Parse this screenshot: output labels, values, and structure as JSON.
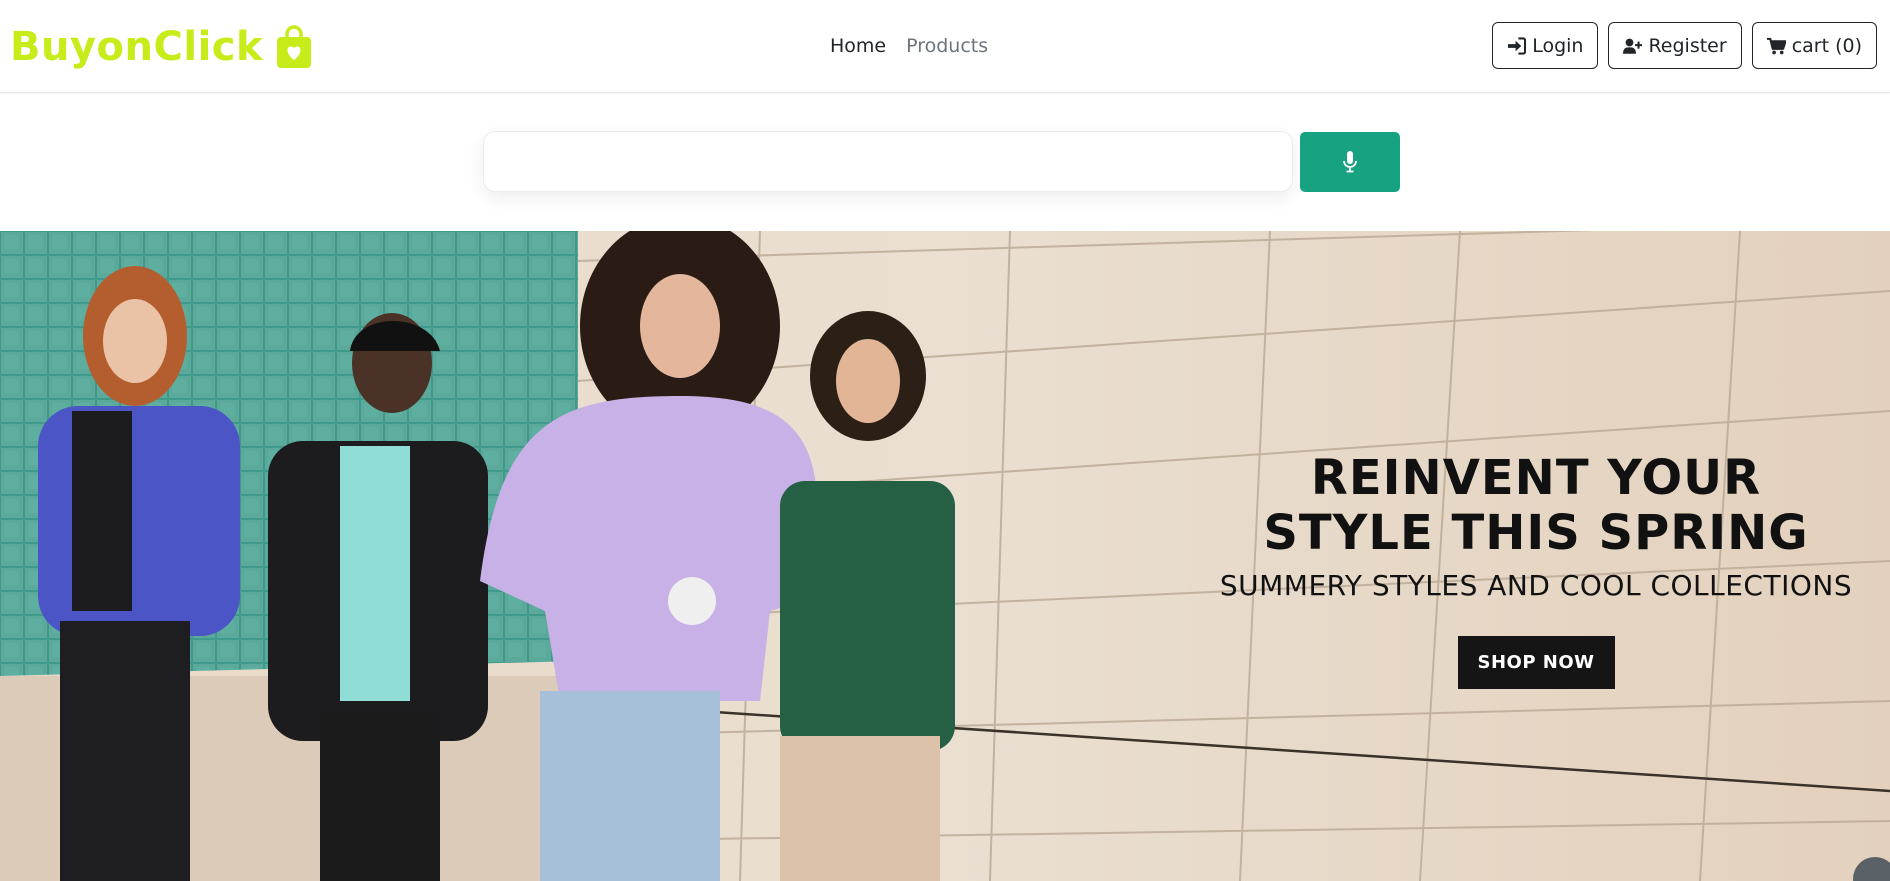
{
  "brand": {
    "name": "BuyonClick",
    "color": "#c6ec19",
    "icon": "shopping-bag-heart-icon"
  },
  "nav": {
    "links": [
      {
        "label": "Home",
        "active": true
      },
      {
        "label": "Products",
        "active": false
      }
    ],
    "buttons": [
      {
        "label": "Login",
        "icon": "sign-in-icon"
      },
      {
        "label": "Register",
        "icon": "user-plus-icon"
      },
      {
        "label": "cart (0)",
        "icon": "cart-icon"
      }
    ]
  },
  "search": {
    "value": "",
    "placeholder": "",
    "mic_icon": "microphone-icon",
    "mic_color": "#17a382"
  },
  "hero": {
    "headline_line1": "REINVENT YOUR",
    "headline_line2": "STYLE THIS SPRING",
    "subheadline": "SUMMERY STYLES AND COOL COLLECTIONS",
    "cta_label": "SHOP NOW"
  }
}
